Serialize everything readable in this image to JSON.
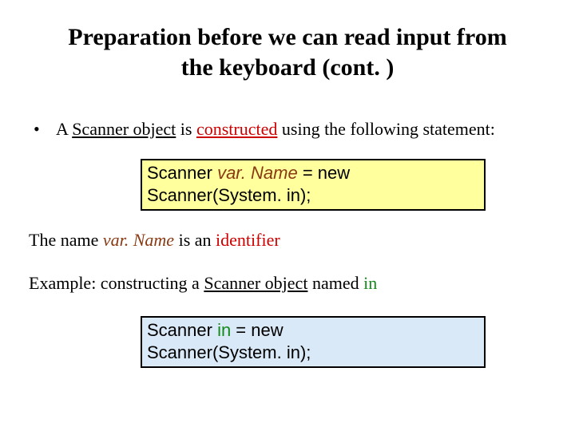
{
  "title_line1": "Preparation before we can read input from",
  "title_line2": "the keyboard (cont. )",
  "bullet": {
    "lead": "A ",
    "scanner_obj": "Scanner object",
    "mid": " is ",
    "constructed": "constructed",
    "tail": " using the following statement:"
  },
  "code1": {
    "t1": "Scanner ",
    "varname": "var. Name",
    "t2": " = new",
    "t3": "Scanner(System. in);"
  },
  "line2": {
    "t1": "The name ",
    "varname": "var. Name",
    "t2": " is an ",
    "identifier_word": "identifier"
  },
  "line3": {
    "t1": "Example: constructing a ",
    "scanner_obj": "Scanner object",
    "t2": " named ",
    "in_word": "in"
  },
  "code2": {
    "t1": "Scanner ",
    "in_word": "in",
    "t2": " = new",
    "t3": "Scanner(System. in);"
  }
}
